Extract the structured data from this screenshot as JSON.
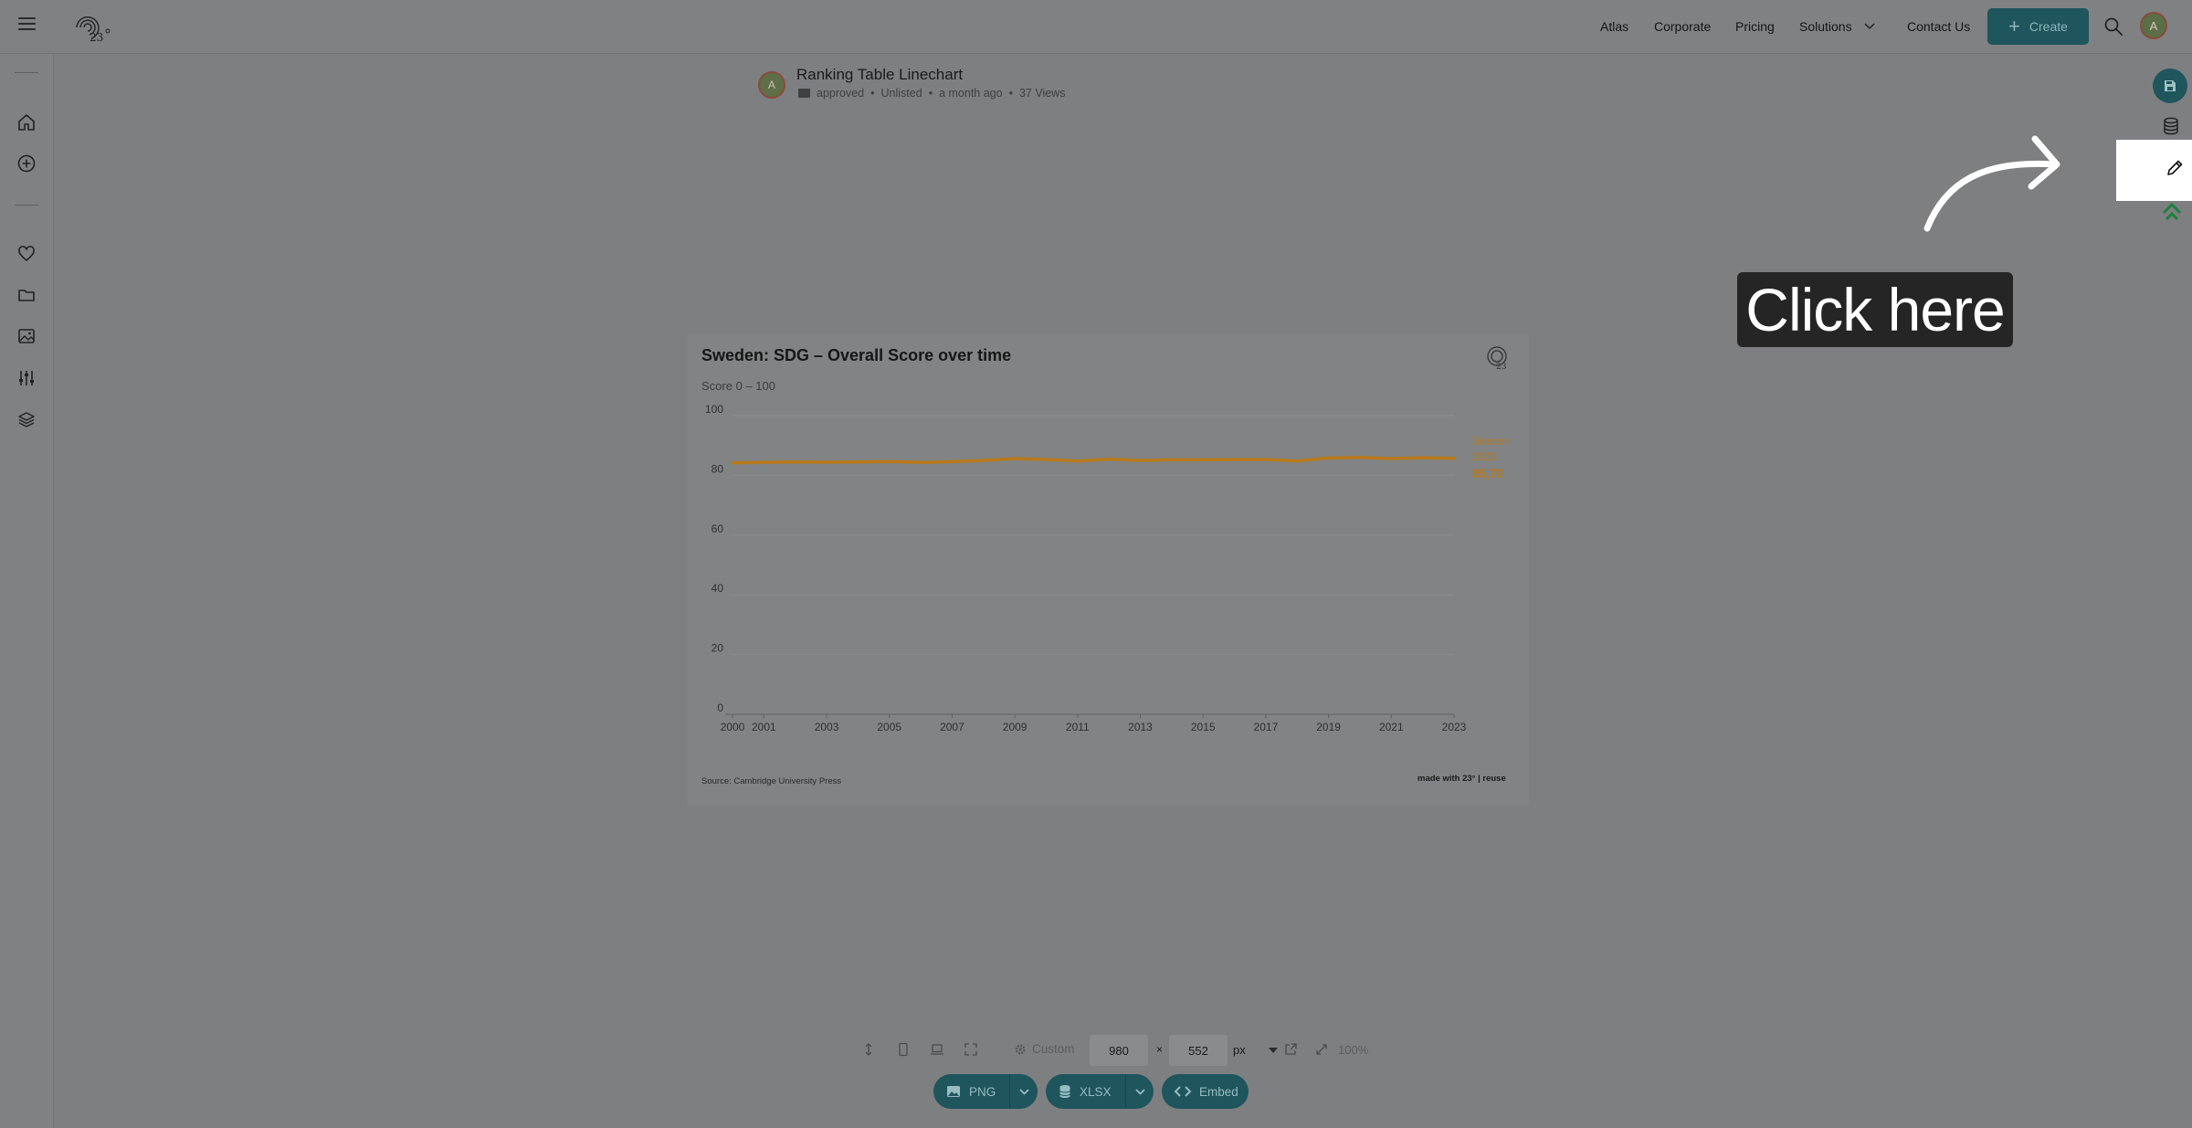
{
  "topbar": {
    "nav": [
      "Atlas",
      "Corporate",
      "Pricing",
      "Solutions",
      "Contact Us"
    ],
    "create_label": "Create",
    "avatar_initial": "A"
  },
  "header": {
    "avatar_initial": "A",
    "title": "Ranking Table Linechart",
    "status": "approved",
    "visibility": "Unlisted",
    "time": "a month ago",
    "views": "37 Views"
  },
  "overlay": {
    "callout": "Click here"
  },
  "chart": {
    "title": "Sweden: SDG – Overall Score over time",
    "subtitle": "Score 0 – 100",
    "source": "Source: Cambridge University Press",
    "made_with": "made with 23° | reuse"
  },
  "chart_data": {
    "type": "line",
    "title": "Sweden: SDG – Overall Score over time",
    "subtitle": "Score 0 – 100",
    "xlabel": "",
    "ylabel": "",
    "ylim": [
      0,
      100
    ],
    "yticks": [
      0,
      20,
      40,
      60,
      80,
      100
    ],
    "xticks": [
      2000,
      2001,
      2003,
      2005,
      2007,
      2009,
      2011,
      2013,
      2015,
      2017,
      2019,
      2021,
      2023
    ],
    "grid": true,
    "x": [
      2000,
      2001,
      2002,
      2003,
      2004,
      2005,
      2006,
      2007,
      2008,
      2009,
      2010,
      2011,
      2012,
      2013,
      2014,
      2015,
      2016,
      2017,
      2018,
      2019,
      2020,
      2021,
      2022,
      2023
    ],
    "series": [
      {
        "name": "Sweden",
        "color": "#b87a1c",
        "values": [
          84.2,
          84.3,
          84.5,
          84.4,
          84.5,
          84.6,
          84.3,
          84.6,
          85.0,
          85.6,
          85.3,
          84.8,
          85.4,
          85.0,
          85.2,
          85.2,
          85.3,
          85.3,
          84.8,
          85.8,
          86.0,
          85.6,
          85.9,
          85.7
        ]
      }
    ],
    "end_label": {
      "name": "Sweden",
      "year": "2023",
      "value": "85,70"
    }
  },
  "toolbar": {
    "preset": "Custom",
    "width": "980",
    "height": "552",
    "dim_sep": "×",
    "unit": "px",
    "zoom": "100%",
    "png_label": "PNG",
    "xlsx_label": "XLSX",
    "embed_label": "Embed"
  },
  "colors": {
    "accent": "#1f555d",
    "series": "#b87a1c",
    "overlay_bg": "#7e7f81"
  }
}
